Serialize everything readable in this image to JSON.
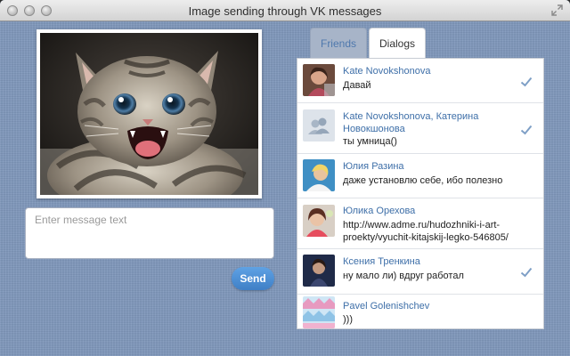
{
  "window": {
    "title": "Image sending through VK messages"
  },
  "composer": {
    "placeholder": "Enter message text",
    "send_label": "Send"
  },
  "tabs": [
    {
      "label": "Friends",
      "active": false
    },
    {
      "label": "Dialogs",
      "active": true
    }
  ],
  "dialogs": [
    {
      "name": "Kate Novokshonova",
      "message": "Давай",
      "read": true
    },
    {
      "name": "Kate Novokshonova, Катерина Новокшонова",
      "message": "ты умница()",
      "read": true
    },
    {
      "name": "Юлия Разина",
      "message": "даже установлю себе, ибо полезно",
      "read": false
    },
    {
      "name": "Юлика Орехова",
      "message": "http://www.adme.ru/hudozhniki-i-art-proekty/vyuchit-kitajskij-legko-546805/",
      "read": false
    },
    {
      "name": "Ксения Тренкина",
      "message": "ну мало ли) вдруг работал",
      "read": true
    },
    {
      "name": "Pavel Golenishchev",
      "message": ")))",
      "read": false
    }
  ],
  "colors": {
    "accent": "#3f7fc6",
    "link": "#3e6fa8",
    "background": "#7f97bb"
  }
}
